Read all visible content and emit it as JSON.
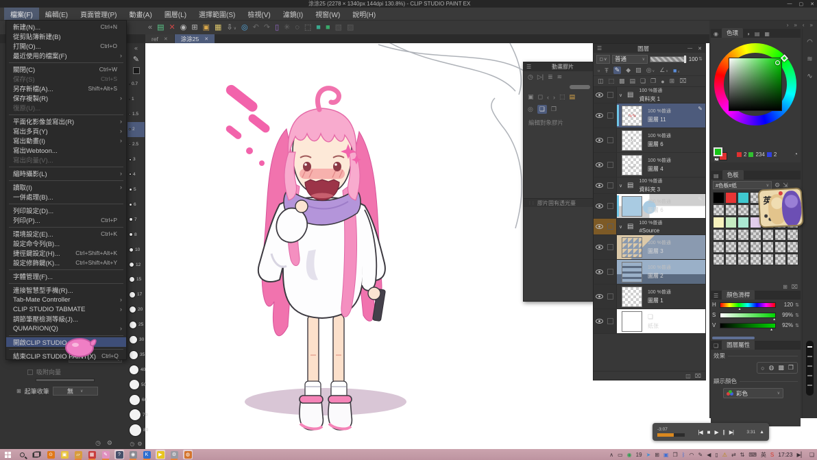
{
  "window": {
    "title": "涂涂25 (2278 × 1340px 144dpi 130.8%)  - CLIP STUDIO PAINT EX",
    "minimize_glyph": "—",
    "maximize_glyph": "▢",
    "close_glyph": "✕"
  },
  "menu_bar": {
    "items": [
      {
        "label": "檔案(F)",
        "active": true
      },
      {
        "label": "編輯(E)"
      },
      {
        "label": "頁面管理(P)"
      },
      {
        "label": "動畫(A)"
      },
      {
        "label": "圖層(L)"
      },
      {
        "label": "選擇範圍(S)"
      },
      {
        "label": "檢視(V)"
      },
      {
        "label": "濾鏡(I)"
      },
      {
        "label": "視窗(W)"
      },
      {
        "label": "說明(H)"
      }
    ]
  },
  "file_menu": {
    "items": [
      {
        "label": "新建(N)...",
        "shortcut": "Ctrl+N"
      },
      {
        "label": "從剪貼簿新建(B)"
      },
      {
        "label": "打開(O)...",
        "shortcut": "Ctrl+O"
      },
      {
        "label": "最近使用的檔案(F)",
        "submenu": true
      },
      {
        "type": "sep"
      },
      {
        "label": "關閉(C)",
        "shortcut": "Ctrl+W"
      },
      {
        "label": "保存(S)",
        "shortcut": "Ctrl+S",
        "disabled": true
      },
      {
        "label": "另存新檔(A)...",
        "shortcut": "Shift+Alt+S"
      },
      {
        "label": "保存複製(R)",
        "submenu": true
      },
      {
        "label": "復原(U)...",
        "disabled": true
      },
      {
        "type": "sep"
      },
      {
        "label": "平面化影像並寫出(R)",
        "submenu": true
      },
      {
        "label": "寫出多頁(Y)",
        "submenu": true
      },
      {
        "label": "寫出動畫(I)",
        "submenu": true
      },
      {
        "label": "寫出Webtoon..."
      },
      {
        "label": "寫出向量(V)...",
        "disabled": true
      },
      {
        "type": "sep"
      },
      {
        "label": "縮時攝影(L)",
        "submenu": true
      },
      {
        "type": "sep"
      },
      {
        "label": "讀取(I)",
        "submenu": true
      },
      {
        "label": "一併處理(B)..."
      },
      {
        "type": "sep"
      },
      {
        "label": "列印設定(D)..."
      },
      {
        "label": "列印(P)...",
        "shortcut": "Ctrl+P"
      },
      {
        "type": "sep"
      },
      {
        "label": "環境設定(E)...",
        "shortcut": "Ctrl+K"
      },
      {
        "label": "設定命令列(B)..."
      },
      {
        "label": "捷徑鍵設定(H)...",
        "shortcut": "Ctrl+Shift+Alt+K"
      },
      {
        "label": "設定修飾鍵(K)...",
        "shortcut": "Ctrl+Shift+Alt+Y"
      },
      {
        "type": "sep"
      },
      {
        "label": "字體管理(F)..."
      },
      {
        "type": "sep"
      },
      {
        "label": "連接智慧型手機(R)..."
      },
      {
        "label": "Tab-Mate Controller",
        "submenu": true
      },
      {
        "label": "CLIP STUDIO TABMATE",
        "submenu": true
      },
      {
        "label": "調節筆壓檢測等級(J)..."
      },
      {
        "label": "QUMARION(Q)",
        "submenu": true
      },
      {
        "type": "sep"
      },
      {
        "label": "開啟CLIP STUDIO...",
        "highlighted": true
      },
      {
        "type": "sep"
      },
      {
        "label": "結束CLIP STUDIO PAINT(X)",
        "shortcut": "Ctrl+Q"
      }
    ]
  },
  "command_bar": {
    "icons": [
      {
        "name": "collapse-icon",
        "glyph": "«",
        "color": "#999999"
      },
      {
        "name": "workspace-icon",
        "glyph": "▤",
        "color": "#5bc88a"
      },
      {
        "name": "close-canvas-icon",
        "glyph": "✕",
        "color": "#d04848"
      },
      {
        "name": "turntable-icon",
        "glyph": "◉",
        "color": "#b8b8b8"
      },
      {
        "name": "new-page-icon",
        "glyph": "⊞",
        "color": "#b8b8b8"
      },
      {
        "name": "open-file-icon",
        "glyph": "▣",
        "color": "#d9a74a"
      },
      {
        "name": "save-file-icon",
        "glyph": "▦",
        "color": "#d9c36a"
      },
      {
        "name": "export-icon",
        "glyph": "⇩",
        "color": "#a8a8a8",
        "chevron": true
      },
      {
        "name": "record-icon",
        "glyph": "◎",
        "color": "#52a8e0"
      },
      {
        "name": "undo-icon",
        "glyph": "↶",
        "color": "#6a6a6a"
      },
      {
        "name": "redo-icon",
        "glyph": "↷",
        "color": "#6a6a6a"
      },
      {
        "name": "panel-icon",
        "glyph": "▯",
        "color": "#9a6ad0"
      },
      {
        "name": "process-icon",
        "glyph": "✳",
        "color": "#666666"
      },
      {
        "name": "silhouette-icon",
        "glyph": "◌",
        "color": "#8a8a8a"
      },
      {
        "name": "crop-icon",
        "glyph": "⬚",
        "color": "#8a8a8a"
      },
      {
        "name": "mat-color-icon-1",
        "glyph": "■",
        "color": "#3aa88f"
      },
      {
        "name": "mat-color-icon-2",
        "glyph": "■",
        "color": "#3aa86a"
      },
      {
        "name": "select-rect-icon",
        "glyph": "▧",
        "color": "#5a5a5a"
      },
      {
        "name": "select-rect2-icon",
        "glyph": "▨",
        "color": "#5a5a5a"
      }
    ]
  },
  "tabs": [
    {
      "label": "ref",
      "close_glyph": "✕"
    },
    {
      "label": "涂涂25",
      "close_glyph": "✕",
      "active": true
    }
  ],
  "brush_sizes": {
    "items": [
      {
        "label": "0.7",
        "size": 2
      },
      {
        "label": "1",
        "size": 2
      },
      {
        "label": "1.5",
        "size": 3
      },
      {
        "label": "2",
        "size": 3,
        "selected": true
      },
      {
        "label": "2.5",
        "size": 3
      },
      {
        "label": "3",
        "size": 4
      },
      {
        "label": "4",
        "size": 4
      },
      {
        "label": "5",
        "size": 5
      },
      {
        "label": "6",
        "size": 5
      },
      {
        "label": "7",
        "size": 6
      },
      {
        "label": "8",
        "size": 6
      },
      {
        "label": "10",
        "size": 7
      },
      {
        "label": "12",
        "size": 8
      },
      {
        "label": "15",
        "size": 9
      },
      {
        "label": "17",
        "size": 10
      },
      {
        "label": "20",
        "size": 11
      },
      {
        "label": "25",
        "size": 12
      },
      {
        "label": "30",
        "size": 13
      },
      {
        "label": "35",
        "size": 14
      },
      {
        "label": "40",
        "size": 15
      },
      {
        "label": "50",
        "size": 16
      },
      {
        "label": "60",
        "size": 17
      },
      {
        "label": "70",
        "size": 18
      },
      {
        "label": "80",
        "size": 19
      }
    ]
  },
  "tool_property": {
    "snap_vector_label": "吸附向量",
    "stroke_label": "起筆收筆",
    "stroke_value": "無"
  },
  "cel_panel": {
    "title": "動畫膠片",
    "edit_target_label": "編輯對象膠片",
    "light_table_label": "膠片固有透光臺",
    "icons_row1": [
      {
        "name": "time-icon",
        "glyph": "◷"
      },
      {
        "name": "flip-icon",
        "glyph": "▷|"
      },
      {
        "name": "onion-skin-icon",
        "glyph": "≣"
      },
      {
        "name": "layer-stack-icon",
        "glyph": "≋"
      }
    ],
    "icons_row2": [
      {
        "name": "image-icon",
        "glyph": "▣"
      },
      {
        "name": "lock-cel-icon",
        "glyph": "◻"
      },
      {
        "name": "prev-cel-icon",
        "glyph": "‹"
      },
      {
        "name": "next-cel-icon",
        "glyph": "›"
      },
      {
        "name": "new-cel-icon",
        "glyph": "⬚"
      },
      {
        "name": "cel-folder-icon",
        "glyph": "▤",
        "color": "#d9a74a"
      }
    ],
    "icons_row3": [
      {
        "name": "light-table-icon",
        "glyph": "◎"
      },
      {
        "name": "register-cel-icon",
        "glyph": "❏",
        "active": true
      },
      {
        "name": "register-cel2-icon",
        "glyph": "❐"
      }
    ]
  },
  "layers_panel": {
    "title": "圖層",
    "blend_mode": "普通",
    "opacity_value": "100",
    "toolbar_row1": [
      {
        "name": "palette-opt-icon",
        "glyph": "▫"
      },
      {
        "name": "clip-at-layer-icon",
        "glyph": "Ŧ"
      },
      {
        "name": "draft-layer-icon",
        "glyph": "✎",
        "active": true
      },
      {
        "name": "lock-layer-icon",
        "glyph": "◆"
      },
      {
        "name": "lock-transparent-icon",
        "glyph": "▨"
      },
      {
        "name": "reference-layer-icon",
        "glyph": "◎",
        "chevron": true
      },
      {
        "name": "ruler-icon",
        "glyph": "∠",
        "chevron": true
      },
      {
        "name": "layer-color-icon",
        "glyph": "■",
        "color": "#5b8dd9",
        "chevron": true
      }
    ],
    "toolbar_row2": [
      {
        "name": "two-pane-icon",
        "glyph": "◫"
      },
      {
        "name": "mask-icon",
        "glyph": "⬚"
      },
      {
        "name": "tone-icon",
        "glyph": "▩"
      },
      {
        "name": "new-folder-icon",
        "glyph": "▤"
      },
      {
        "name": "merge-down-icon",
        "glyph": "❏"
      },
      {
        "name": "merge-icon",
        "glyph": "❐"
      },
      {
        "name": "fill-icon",
        "glyph": "●"
      },
      {
        "name": "new-layer-icon",
        "glyph": "⊞"
      },
      {
        "name": "delete-layer-icon",
        "glyph": "⌧"
      }
    ],
    "rows": [
      {
        "kind": "folder",
        "open": true,
        "opacity_label": "100 %普通",
        "name": "資料夾 1"
      },
      {
        "kind": "layer",
        "selected": true,
        "pen": true,
        "bar": true,
        "thumb": "scribble",
        "opacity_label": "100 %普通",
        "name": "圖層 11",
        "mark": "∿∿"
      },
      {
        "kind": "layer",
        "thumb": "sketch",
        "opacity_label": "100 %普通",
        "name": "圖層 6",
        "mark": "⌇"
      },
      {
        "kind": "layer",
        "thumb": "sketch2",
        "opacity_label": "100 %普通",
        "name": "圖層 4",
        "mark": "﹏"
      },
      {
        "kind": "folder",
        "opacity_label": "100 %普通",
        "name": "資料夾 3"
      },
      {
        "kind": "layer",
        "bar": true,
        "pen": true,
        "thumb": "figure",
        "opacity_label": "100 %普通",
        "name": "圖層 6",
        "mark": ""
      },
      {
        "kind": "folder",
        "open": true,
        "source": true,
        "opacity_label": "100 %普通",
        "name": "#Source"
      },
      {
        "kind": "layer",
        "thumb": "photo1",
        "opacity_label": "100 %普通",
        "name": "圖層 3",
        "mark": ""
      },
      {
        "kind": "layer",
        "thumb": "photo2",
        "opacity_label": "100 %普通",
        "name": "圖層 2",
        "mark": ""
      },
      {
        "kind": "layer",
        "thumb": "blank",
        "opacity_label": "100 %普通",
        "name": "圖層 1",
        "mark": ""
      },
      {
        "kind": "paper",
        "thumb": "white",
        "opacity_label": "",
        "name": "纸张",
        "mark": ""
      }
    ]
  },
  "right_dock": {
    "minibar": [
      {
        "name": "expand-right-icon",
        "glyph": "›"
      },
      {
        "name": "expand-all-icon",
        "glyph": "»"
      },
      {
        "name": "collapse-left-icon",
        "glyph": "‹"
      },
      {
        "name": "dock-icon",
        "glyph": "»"
      }
    ],
    "strip_icons": [
      {
        "name": "navigator-icon",
        "glyph": "◠"
      },
      {
        "name": "subview-icon",
        "glyph": "≋"
      },
      {
        "name": "item-bank-icon",
        "glyph": "∿"
      }
    ]
  },
  "color_wheel": {
    "tab": "色環",
    "tab_icons": [
      {
        "name": "tab-mixer-icon",
        "glyph": "◑"
      },
      {
        "name": "tab-approx-icon",
        "glyph": "▤"
      },
      {
        "name": "tab-history-icon",
        "glyph": "▦"
      }
    ],
    "r": "2",
    "g": "234",
    "b": "2",
    "fg_color": "#17c517",
    "bg_color": "#e03030"
  },
  "color_set": {
    "tab": "色板",
    "set_name": "#色板#纸",
    "sticker_char": "英",
    "sticker_moon": "☾",
    "cells": [
      "#000000",
      "#e83535",
      "#3fc8cf",
      "checker",
      "checker",
      "checker",
      "checker",
      "checker",
      "checker",
      "checker",
      "checker",
      "checker",
      "checker",
      "checker",
      "#f7f2bd",
      "#c6ecc2",
      "#abe8d2",
      "#e2cdec",
      "#f6cfa9",
      "checker",
      "checker",
      "checker",
      "checker",
      "checker",
      "checker",
      "checker",
      "checker",
      "checker",
      "checker",
      "checker",
      "checker",
      "checker",
      "checker",
      "checker",
      "checker",
      "checker",
      "checker",
      "checker",
      "checker",
      "checker",
      "checker",
      "checker"
    ]
  },
  "color_slider": {
    "title": "顏色滑桿",
    "h_label": "H",
    "h_value": "120",
    "s_label": "S",
    "s_value": "99%",
    "v_label": "V",
    "v_value": "92%",
    "spin_glyph": "⇅"
  },
  "layer_property": {
    "title": "圖層屬性",
    "effect_label": "效果",
    "display_color_label": "顯示顏色",
    "color_mode": "彩色",
    "effect_icons": [
      {
        "name": "effect-none-icon",
        "glyph": "○"
      },
      {
        "name": "effect-border-icon",
        "glyph": "◍"
      },
      {
        "name": "effect-tone-icon",
        "glyph": "▩"
      },
      {
        "name": "effect-expression-icon",
        "glyph": "❐",
        "chevron": true
      }
    ]
  },
  "timeline": {
    "current": "-3:07",
    "total": "3:31",
    "buttons": [
      {
        "name": "skip-start-icon",
        "glyph": "|◀"
      },
      {
        "name": "stop-icon",
        "glyph": "■"
      },
      {
        "name": "play-icon",
        "glyph": "▶"
      },
      {
        "name": "pause-icon",
        "glyph": "||"
      },
      {
        "name": "skip-end-icon",
        "glyph": "▶|"
      }
    ],
    "expand_glyph": "▲"
  },
  "taskbar": {
    "time": "17:23",
    "apps": [
      {
        "name": "app-everything",
        "color": "#e07818",
        "glyph": "⊙"
      },
      {
        "name": "app-locker",
        "color": "#e8c23c",
        "glyph": "▣"
      },
      {
        "name": "app-explorer",
        "color": "#d89c3c",
        "glyph": "▱",
        "running": true
      },
      {
        "name": "app-grid-red",
        "color": "#c83c3c",
        "glyph": "▦",
        "running": true
      },
      {
        "name": "app-paint",
        "color": "#e090c0",
        "glyph": "✎",
        "running": true
      },
      {
        "name": "app-dark",
        "color": "#46506a",
        "glyph": "?",
        "active": true
      },
      {
        "name": "app-capture",
        "color": "#8a8a92",
        "glyph": "◉",
        "running": true
      },
      {
        "name": "app-kv",
        "color": "#2f6fd0",
        "glyph": "K",
        "running": true
      },
      {
        "name": "app-player",
        "color": "#e8c520",
        "glyph": "▶",
        "active": true
      },
      {
        "name": "app-settings",
        "color": "#9a9aa2",
        "glyph": "⚙",
        "running": true
      },
      {
        "name": "app-orange",
        "color": "#d4742c",
        "glyph": "◍",
        "active": true
      }
    ],
    "tray_left": [
      {
        "name": "tray-expand-icon",
        "glyph": "∧"
      },
      {
        "name": "tablet-icon",
        "glyph": "▭"
      },
      {
        "name": "resume-icon",
        "glyph": "◉",
        "color": "#2f9e4f"
      },
      {
        "name": "update-count-badge",
        "glyph": "19"
      },
      {
        "name": "telegram-icon",
        "glyph": "➤",
        "color": "#3f8fd4"
      },
      {
        "name": "pin-app-icon",
        "glyph": "⊞"
      },
      {
        "name": "display-settings-icon",
        "glyph": "▣",
        "color": "#3f6fd4"
      },
      {
        "name": "window-app-icon",
        "glyph": "❐"
      },
      {
        "name": "bluetooth-icon",
        "glyph": "ᛒ",
        "color": "#3f6fd4"
      },
      {
        "name": "wifi-icon",
        "glyph": "◠"
      },
      {
        "name": "pen-tablet-icon",
        "glyph": "✎"
      },
      {
        "name": "volume-icon",
        "glyph": "◀"
      },
      {
        "name": "phone-link-icon",
        "glyph": "▯"
      },
      {
        "name": "account-alert-icon",
        "glyph": "⚠",
        "color": "#b8860b"
      },
      {
        "name": "sync-icon",
        "glyph": "⇄"
      },
      {
        "name": "input-switch-icon",
        "glyph": "⇅"
      },
      {
        "name": "keyboard-icon",
        "glyph": "⌨"
      },
      {
        "name": "ime-lang-indicator",
        "glyph": "英"
      },
      {
        "name": "sogou-icon",
        "glyph": "S",
        "color": "#d8382a"
      }
    ],
    "tray_right": [
      {
        "name": "media-popup-icon",
        "glyph": "▶▏"
      },
      {
        "name": "notification-icon",
        "glyph": "❏"
      }
    ]
  }
}
